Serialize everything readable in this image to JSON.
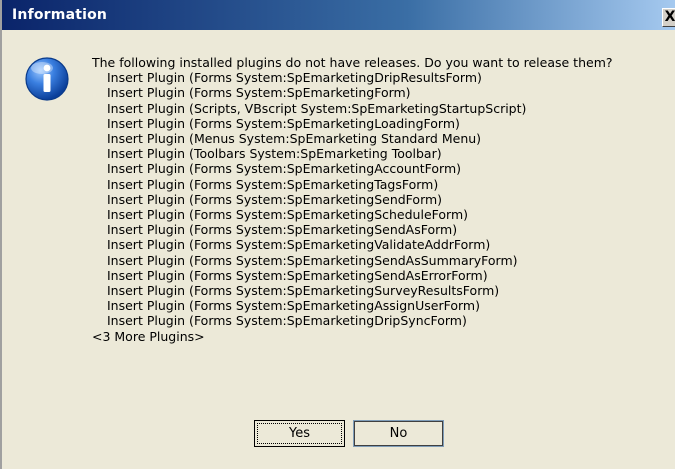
{
  "window": {
    "title": "Information",
    "close_label": "X"
  },
  "message": {
    "icon": "info-icon",
    "prompt": "The following installed plugins do not have releases.  Do you want to release them?",
    "plugins": [
      "Insert Plugin (Forms System:SpEmarketingDripResultsForm)",
      "Insert Plugin (Forms System:SpEmarketingForm)",
      "Insert Plugin (Scripts, VBscript System:SpEmarketingStartupScript)",
      "Insert Plugin (Forms System:SpEmarketingLoadingForm)",
      "Insert Plugin (Menus System:SpEmarketing Standard Menu)",
      "Insert Plugin (Toolbars System:SpEmarketing Toolbar)",
      "Insert Plugin (Forms System:SpEmarketingAccountForm)",
      "Insert Plugin (Forms System:SpEmarketingTagsForm)",
      "Insert Plugin (Forms System:SpEmarketingSendForm)",
      "Insert Plugin (Forms System:SpEmarketingScheduleForm)",
      "Insert Plugin (Forms System:SpEmarketingSendAsForm)",
      "Insert Plugin (Forms System:SpEmarketingValidateAddrForm)",
      "Insert Plugin (Forms System:SpEmarketingSendAsSummaryForm)",
      "Insert Plugin (Forms System:SpEmarketingSendAsErrorForm)",
      "Insert Plugin (Forms System:SpEmarketingSurveyResultsForm)",
      "Insert Plugin (Forms System:SpEmarketingAssignUserForm)",
      "Insert Plugin (Forms System:SpEmarketingDripSyncForm)"
    ],
    "more": "<3 More Plugins>"
  },
  "buttons": {
    "yes_label": "Yes",
    "no_label": "No"
  },
  "colors": {
    "titlebar_start": "#0a246a",
    "titlebar_end": "#a6caf0",
    "dialog_bg": "#ece9d8",
    "icon_blue": "#1f5fbf"
  }
}
